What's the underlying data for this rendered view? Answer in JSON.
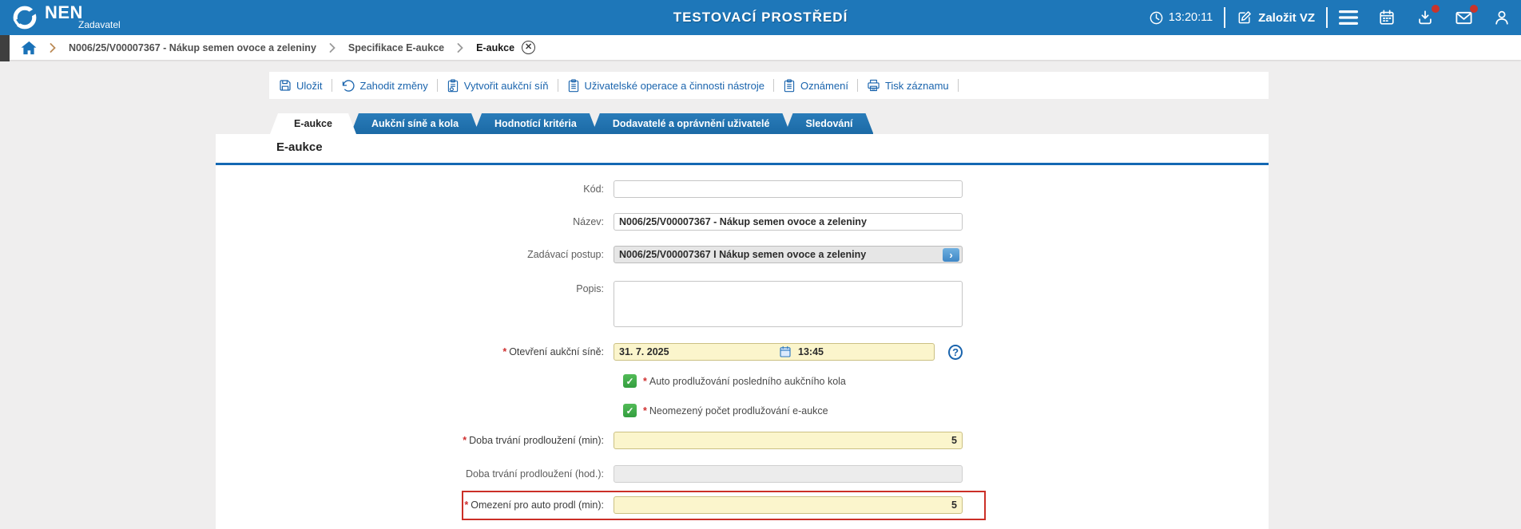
{
  "colors": {
    "topbar_blue": "#1e77b9",
    "tab_blue": "#1b6aa6",
    "link_blue": "#1a64ad",
    "title_underline": "#1468b3",
    "required_field_bg": "#fbf5cc",
    "disabled_field_bg": "#ececec",
    "checkbox_green": "#3fae49",
    "badge_red": "#c9342c",
    "alert_border_red": "#cb2f27"
  },
  "topbar": {
    "brand": "NEN",
    "role": "Zadavatel",
    "environment": "TESTOVACÍ PROSTŘEDÍ",
    "time": "13:20:11",
    "create_vz": "Založit VZ"
  },
  "breadcrumb": {
    "items": [
      {
        "label": "N006/25/V00007367 - Nákup semen ovoce a zeleniny"
      },
      {
        "label": "Specifikace E-aukce"
      },
      {
        "label": "E-aukce"
      }
    ]
  },
  "toolbar": {
    "items": [
      {
        "label": "Uložit",
        "icon": "save-icon"
      },
      {
        "label": "Zahodit změny",
        "icon": "undo-icon"
      },
      {
        "label": "Vytvořit aukční síň",
        "icon": "clipboard-gear-icon"
      },
      {
        "label": "Uživatelské operace a činnosti nástroje",
        "icon": "clipboard-icon"
      },
      {
        "label": "Oznámení",
        "icon": "clipboard-icon"
      },
      {
        "label": "Tisk záznamu",
        "icon": "printer-icon"
      }
    ]
  },
  "tabs": {
    "items": [
      {
        "label": "E-aukce",
        "active": true
      },
      {
        "label": "Aukční síně a kola",
        "active": false
      },
      {
        "label": "Hodnotící kritéria",
        "active": false
      },
      {
        "label": "Dodavatelé a oprávnění uživatelé",
        "active": false
      },
      {
        "label": "Sledování",
        "active": false
      }
    ]
  },
  "form": {
    "section_title": "E-aukce",
    "kod": {
      "label": "Kód:",
      "value": ""
    },
    "nazev": {
      "label": "Název:",
      "value": "N006/25/V00007367 - Nákup semen ovoce a zeleniny"
    },
    "zadavaci_postup": {
      "label": "Zadávací postup:",
      "value": "N006/25/V00007367 I Nákup semen ovoce a zeleniny"
    },
    "popis": {
      "label": "Popis:",
      "value": ""
    },
    "otevreni": {
      "label": "Otevření aukční síně:",
      "required": true,
      "date": "31. 7. 2025",
      "time": "13:45"
    },
    "auto_prodluzovani": {
      "label": "Auto prodlužování posledního aukčního kola",
      "required": true,
      "checked": true
    },
    "neomezeny_pocet": {
      "label": "Neomezený počet prodlužování e-aukce",
      "required": true,
      "checked": true
    },
    "doba_min": {
      "label": "Doba trvání prodloužení (min):",
      "required": true,
      "value": "5"
    },
    "doba_hod": {
      "label": "Doba trvání prodloužení (hod.):",
      "required": false,
      "value": ""
    },
    "omezeni": {
      "label": "Omezení pro auto prodl (min):",
      "required": true,
      "value": "5",
      "highlighted": true
    }
  }
}
